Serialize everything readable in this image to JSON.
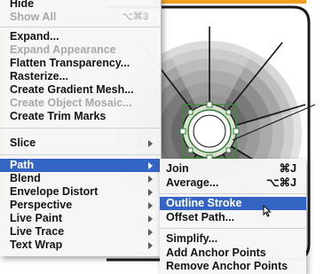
{
  "menu": {
    "items": [
      {
        "label": "Hide",
        "enabled": true
      },
      {
        "label": "Show All",
        "shortcut": "⌥⌘3",
        "enabled": false
      },
      {
        "label": "Expand...",
        "enabled": true
      },
      {
        "label": "Expand Appearance",
        "enabled": false
      },
      {
        "label": "Flatten Transparency...",
        "enabled": true
      },
      {
        "label": "Rasterize...",
        "enabled": true
      },
      {
        "label": "Create Gradient Mesh...",
        "enabled": true
      },
      {
        "label": "Create Object Mosaic...",
        "enabled": false
      },
      {
        "label": "Create Trim Marks",
        "enabled": true
      },
      {
        "label": "Slice",
        "enabled": true
      },
      {
        "label": "Path",
        "enabled": true,
        "selected": true
      },
      {
        "label": "Blend",
        "enabled": true
      },
      {
        "label": "Envelope Distort",
        "enabled": true
      },
      {
        "label": "Perspective",
        "enabled": true
      },
      {
        "label": "Live Paint",
        "enabled": true
      },
      {
        "label": "Live Trace",
        "enabled": true
      },
      {
        "label": "Text Wrap",
        "enabled": true
      }
    ]
  },
  "submenu": {
    "items": [
      {
        "label": "Join",
        "shortcut": "⌘J"
      },
      {
        "label": "Average...",
        "shortcut": "⌥⌘J"
      },
      {
        "label": "Outline Stroke",
        "selected": true
      },
      {
        "label": "Offset Path..."
      },
      {
        "label": "Simplify..."
      },
      {
        "label": "Add Anchor Points"
      },
      {
        "label": "Remove Anchor Points"
      }
    ]
  },
  "colors": {
    "highlight": "#3465c4",
    "artboard_border": "#1a1a1a",
    "accent_orange": "#f0a020",
    "disabled_text": "#a8a8a8"
  },
  "icons": [
    "arrow-cursor-icon",
    "submenu-arrow-icon"
  ]
}
